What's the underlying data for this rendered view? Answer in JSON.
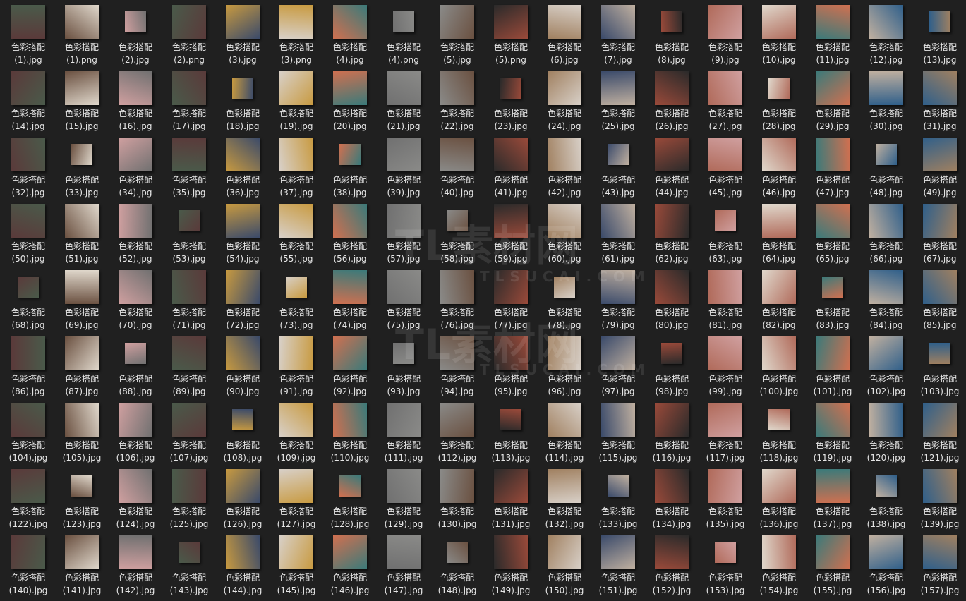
{
  "prefix": "色彩搭配",
  "files": [
    "(1).jpg",
    "(1).png",
    "(2).jpg",
    "(2).png",
    "(3).jpg",
    "(3).png",
    "(4).jpg",
    "(4).png",
    "(5).jpg",
    "(5).png",
    "(6).jpg",
    "(7).jpg",
    "(8).jpg",
    "(9).jpg",
    "(10).jpg",
    "(11).jpg",
    "(12).jpg",
    "(13).jpg"
  ],
  "numbered_range": [
    14,
    157
  ],
  "extension": ".jpg",
  "thumb_palette": [
    "#5a3a3a",
    "#b06a5a",
    "#8a8a88",
    "#4a5a4a",
    "#c0b0a0",
    "#3a4a6a",
    "#d07050",
    "#6a5040",
    "#e0d8cc",
    "#2a2a2a",
    "#c89a40",
    "#2f5f8a",
    "#9a4a3a",
    "#707070",
    "#d0a0a0",
    "#3a7a7a",
    "#a08060",
    "#d8d0c8"
  ],
  "watermark": {
    "brand": "TL素材网",
    "url": "TLSUCAI.COM"
  }
}
